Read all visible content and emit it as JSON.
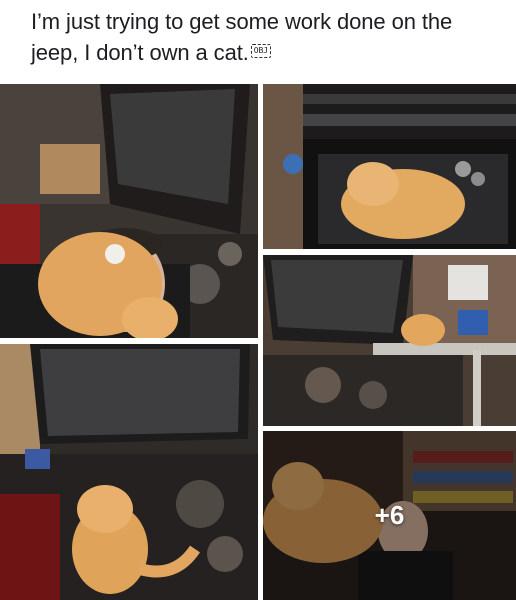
{
  "post": {
    "caption": "I’m just trying to get some work done on the jeep, I don’t own a cat.",
    "caption_badge": "OBJ"
  },
  "gallery": {
    "more_count_label": "+6",
    "photos": [
      {
        "subject": "selfie-man-holding-orange-cat"
      },
      {
        "subject": "orange-cat-in-toolbox-drawer"
      },
      {
        "subject": "cat-on-engine-bay-ladder"
      },
      {
        "subject": "orange-cat-on-jeep-engine"
      },
      {
        "subject": "cat-on-shoulder-in-garage"
      }
    ]
  },
  "colors": {
    "cat_orange": "#e0a35a",
    "engine_dark": "#2f2b28",
    "garage_brown": "#5a4636",
    "text": "#1c1e21"
  }
}
